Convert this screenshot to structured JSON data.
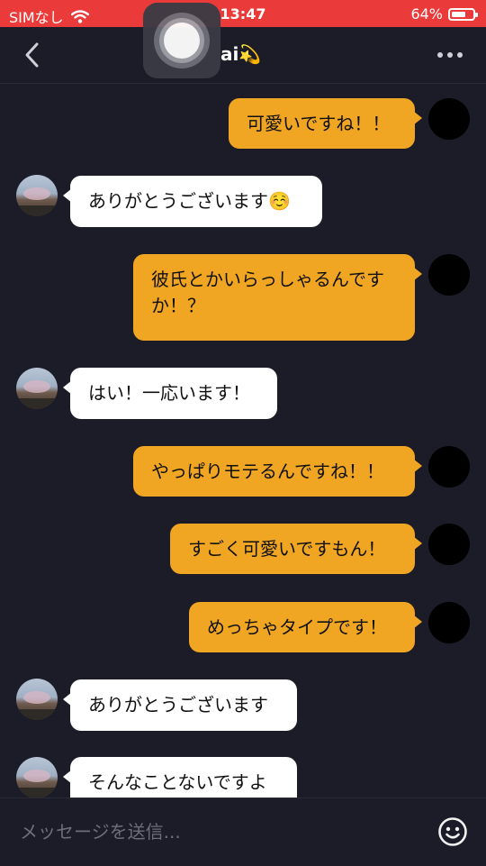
{
  "status_bar": {
    "carrier": "SIMなし",
    "time": "13:47",
    "battery": "64%"
  },
  "header": {
    "title": "ai💫"
  },
  "messages": [
    {
      "side": "out",
      "text": "可愛いですね！！"
    },
    {
      "side": "in",
      "text": "ありがとうございます☺️"
    },
    {
      "side": "out",
      "text": "彼氏とかいらっしゃるんです\nか！？"
    },
    {
      "side": "in",
      "text": "はい！一応います！"
    },
    {
      "side": "out",
      "text": "やっぱりモテるんですね！！"
    },
    {
      "side": "out",
      "text": "すごく可愛いですもん！"
    },
    {
      "side": "out",
      "text": "めっちゃタイプです！"
    },
    {
      "side": "in",
      "text": "ありがとうございます"
    },
    {
      "side": "in",
      "text": "そんなことないですよ"
    }
  ],
  "composer": {
    "placeholder": "メッセージを送信..."
  },
  "icons": [
    "wifi-icon",
    "battery-icon",
    "back-chevron-icon",
    "more-dots-icon",
    "smiley-icon",
    "assistive-touch-icon"
  ],
  "colors": {
    "status_bar": "#ea3b3a",
    "background": "#1b1c27",
    "outgoing_bubble": "#f0a623",
    "incoming_bubble": "#ffffff"
  }
}
